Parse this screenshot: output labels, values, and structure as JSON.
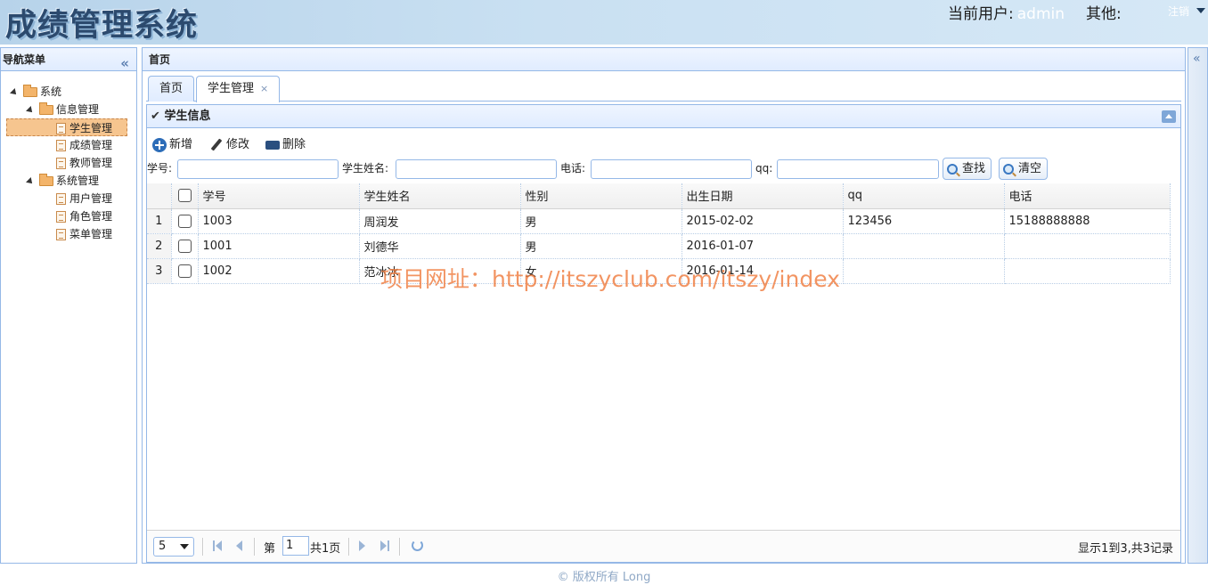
{
  "header": {
    "title": "成绩管理系统",
    "current_user_label": "当前用户:",
    "username": "admin",
    "other_label": "其他:",
    "logout_label": "注销"
  },
  "nav": {
    "title": "导航菜单",
    "tree": {
      "root": "系统",
      "groups": [
        {
          "label": "信息管理",
          "items": [
            "学生管理",
            "成绩管理",
            "教师管理"
          ]
        },
        {
          "label": "系统管理",
          "items": [
            "用户管理",
            "角色管理",
            "菜单管理"
          ]
        }
      ],
      "selected": "学生管理"
    }
  },
  "center": {
    "title": "首页",
    "tabs": [
      {
        "label": "首页"
      },
      {
        "label": "学生管理",
        "close": "×"
      }
    ]
  },
  "panel": {
    "title": "学生信息",
    "toolbar": {
      "add": "新增",
      "edit": "修改",
      "delete": "删除"
    },
    "search": {
      "student_no_label": "学号:",
      "student_name_label": "学生姓名:",
      "phone_label": "电话:",
      "qq_label": "qq:",
      "search_button": "查找",
      "clear_button": "清空"
    },
    "grid": {
      "columns": [
        "学号",
        "学生姓名",
        "性别",
        "出生日期",
        "qq",
        "电话"
      ],
      "rows": [
        {
          "num": "1",
          "student_no": "1003",
          "name": "周润发",
          "gender": "男",
          "birth": "2015-02-02",
          "qq": "123456",
          "phone": "15188888888"
        },
        {
          "num": "2",
          "student_no": "1001",
          "name": "刘德华",
          "gender": "男",
          "birth": "2016-01-07",
          "qq": "",
          "phone": ""
        },
        {
          "num": "3",
          "student_no": "1002",
          "name": "范冰冰",
          "gender": "女",
          "birth": "2016-01-14",
          "qq": "",
          "phone": ""
        }
      ]
    },
    "watermark": "项目网址：http://itszyclub.com/itszy/index",
    "pager": {
      "page_size": "5",
      "page_prefix": "第",
      "page_number": "1",
      "page_total": "共1页",
      "info": "显示1到3,共3记录"
    }
  },
  "footer": {
    "text": "© 版权所有 Long"
  }
}
